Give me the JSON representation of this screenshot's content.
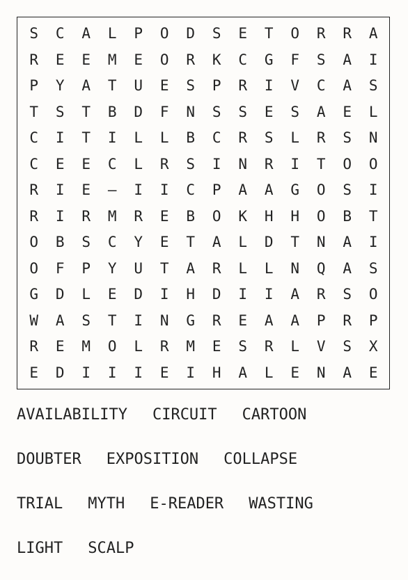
{
  "grid": [
    [
      "S",
      "C",
      "A",
      "L",
      "P",
      "O",
      "D",
      "S",
      "E",
      "T",
      "O",
      "R",
      "R",
      "A"
    ],
    [
      "R",
      "E",
      "E",
      "M",
      "E",
      "O",
      "R",
      "K",
      "C",
      "G",
      "F",
      "S",
      "A",
      "I"
    ],
    [
      "P",
      "Y",
      "A",
      "T",
      "U",
      "E",
      "S",
      "P",
      "R",
      "I",
      "V",
      "C",
      "A",
      "S"
    ],
    [
      "T",
      "S",
      "T",
      "B",
      "D",
      "F",
      "N",
      "S",
      "S",
      "E",
      "S",
      "A",
      "E",
      "L"
    ],
    [
      "C",
      "I",
      "T",
      "I",
      "L",
      "L",
      "B",
      "C",
      "R",
      "S",
      "L",
      "R",
      "S",
      "N"
    ],
    [
      "C",
      "E",
      "E",
      "C",
      "L",
      "R",
      "S",
      "I",
      "N",
      "R",
      "I",
      "T",
      "O",
      "O"
    ],
    [
      "R",
      "I",
      "E",
      "–",
      "I",
      "I",
      "C",
      "P",
      "A",
      "A",
      "G",
      "O",
      "S",
      "I"
    ],
    [
      "R",
      "I",
      "R",
      "M",
      "R",
      "E",
      "B",
      "O",
      "K",
      "H",
      "H",
      "O",
      "B",
      "T"
    ],
    [
      "O",
      "B",
      "S",
      "C",
      "Y",
      "E",
      "T",
      "A",
      "L",
      "D",
      "T",
      "N",
      "A",
      "I"
    ],
    [
      "O",
      "F",
      "P",
      "Y",
      "U",
      "T",
      "A",
      "R",
      "L",
      "L",
      "N",
      "Q",
      "A",
      "S"
    ],
    [
      "G",
      "D",
      "L",
      "E",
      "D",
      "I",
      "H",
      "D",
      "I",
      "I",
      "A",
      "R",
      "S",
      "O"
    ],
    [
      "W",
      "A",
      "S",
      "T",
      "I",
      "N",
      "G",
      "R",
      "E",
      "A",
      "A",
      "P",
      "R",
      "P"
    ],
    [
      "R",
      "E",
      "M",
      "O",
      "L",
      "R",
      "M",
      "E",
      "S",
      "R",
      "L",
      "V",
      "S",
      "X"
    ],
    [
      "E",
      "D",
      "I",
      "I",
      "I",
      "E",
      "I",
      "H",
      "A",
      "L",
      "E",
      "N",
      "A",
      "E"
    ]
  ],
  "word_rows": [
    [
      "AVAILABILITY",
      "CIRCUIT",
      "CARTOON"
    ],
    [
      "DOUBTER",
      "EXPOSITION",
      "COLLAPSE"
    ],
    [
      "TRIAL",
      "MYTH",
      "E-READER",
      "WASTING"
    ],
    [
      "LIGHT",
      "SCALP"
    ]
  ]
}
